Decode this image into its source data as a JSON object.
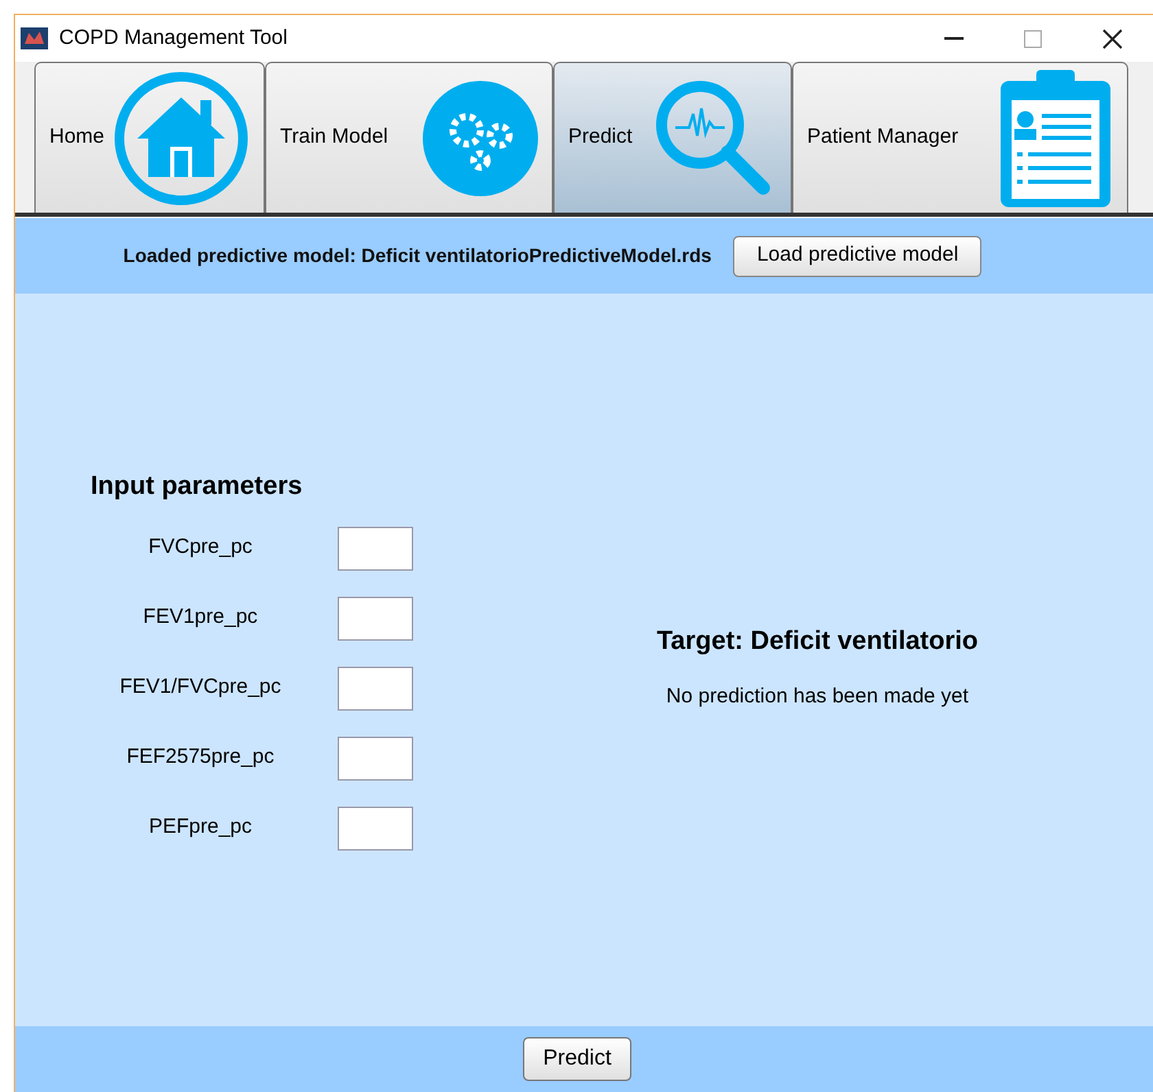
{
  "window": {
    "title": "COPD Management Tool"
  },
  "tabs": [
    {
      "label": "Home",
      "kind": "home",
      "selected": false
    },
    {
      "label": "Train Model",
      "kind": "gears",
      "selected": false
    },
    {
      "label": "Predict",
      "kind": "magnifier",
      "selected": true
    },
    {
      "label": "Patient Manager",
      "kind": "clipboard",
      "selected": false
    }
  ],
  "model_bar": {
    "text": "Loaded predictive model: Deficit ventilatorioPredictiveModel.rds",
    "button": "Load predictive model"
  },
  "inputs": {
    "title": "Input parameters",
    "fields": [
      {
        "label": "FVCpre_pc"
      },
      {
        "label": "FEV1pre_pc"
      },
      {
        "label": "FEV1/FVCpre_pc"
      },
      {
        "label": "FEF2575pre_pc"
      },
      {
        "label": "PEFpre_pc"
      }
    ]
  },
  "target": {
    "title": "Target: Deficit ventilatorio",
    "message": "No prediction has been made yet"
  },
  "footer": {
    "button": "Predict"
  }
}
